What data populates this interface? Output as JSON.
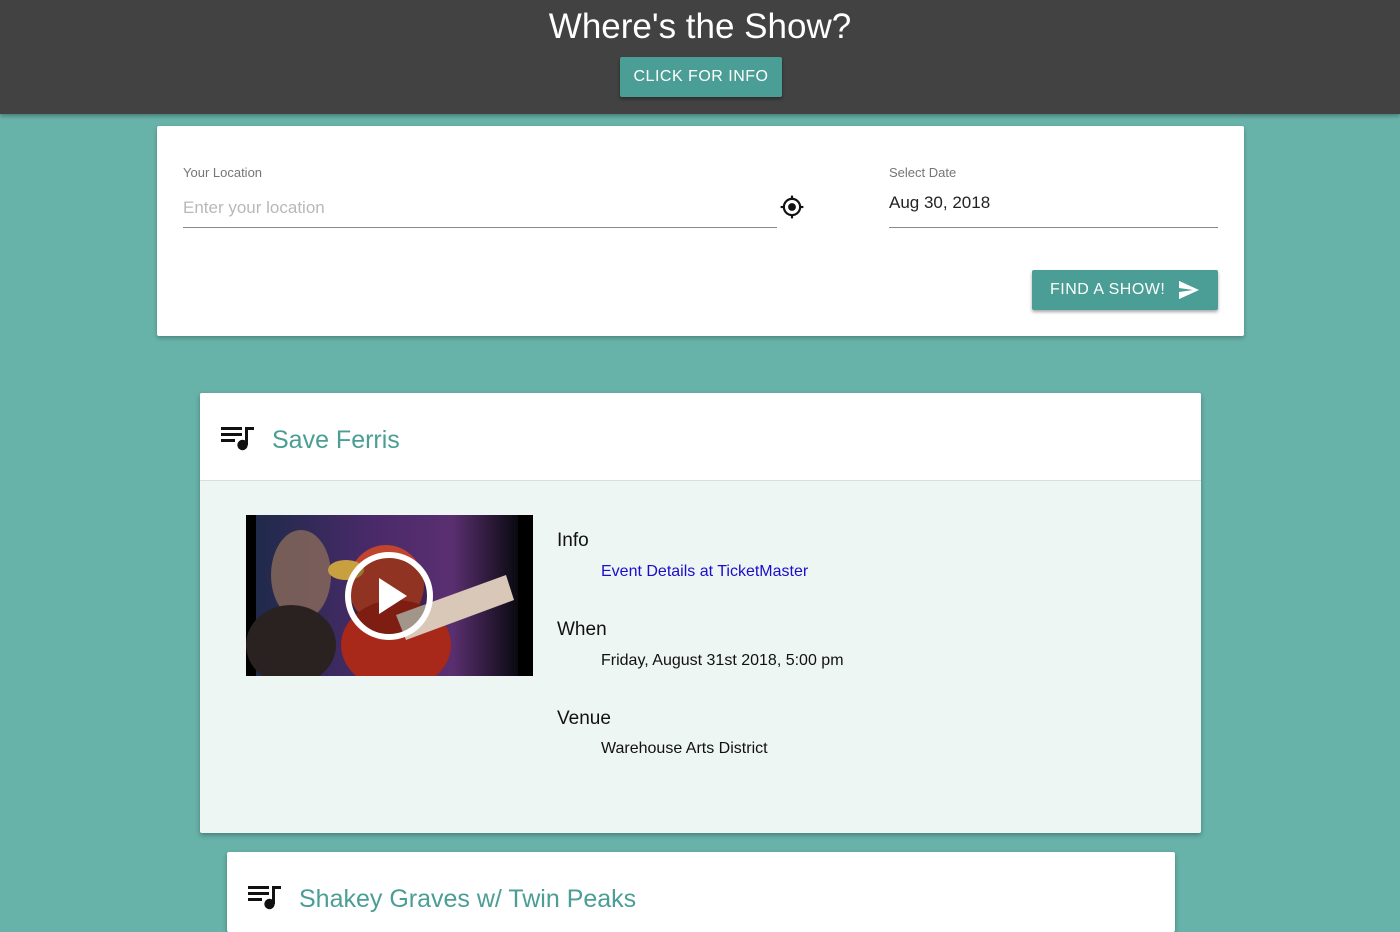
{
  "header": {
    "title": "Where's the Show?",
    "info_button": "CLICK FOR INFO"
  },
  "search": {
    "location_label": "Your Location",
    "location_placeholder": "Enter your location",
    "location_value": "",
    "date_label": "Select Date",
    "date_value": "Aug 30, 2018",
    "find_button": "FIND A SHOW!"
  },
  "shows": [
    {
      "title": "Save Ferris",
      "info_heading": "Info",
      "info_link": "Event Details at TicketMaster",
      "when_heading": "When",
      "when_value": "Friday, August 31st 2018, 5:00 pm",
      "venue_heading": "Venue",
      "venue_value": "Warehouse Arts District"
    },
    {
      "title": "Shakey Graves w/ Twin Peaks"
    }
  ],
  "icons": {
    "locate": "my-location-icon",
    "send": "send-icon",
    "playlist": "queue-music-icon",
    "play": "play-circle-icon"
  },
  "colors": {
    "page_background": "#67b2a9",
    "header_background": "#424242",
    "accent": "#4a9e95",
    "card_body": "#eef6f4",
    "link": "#1a0dcc"
  }
}
